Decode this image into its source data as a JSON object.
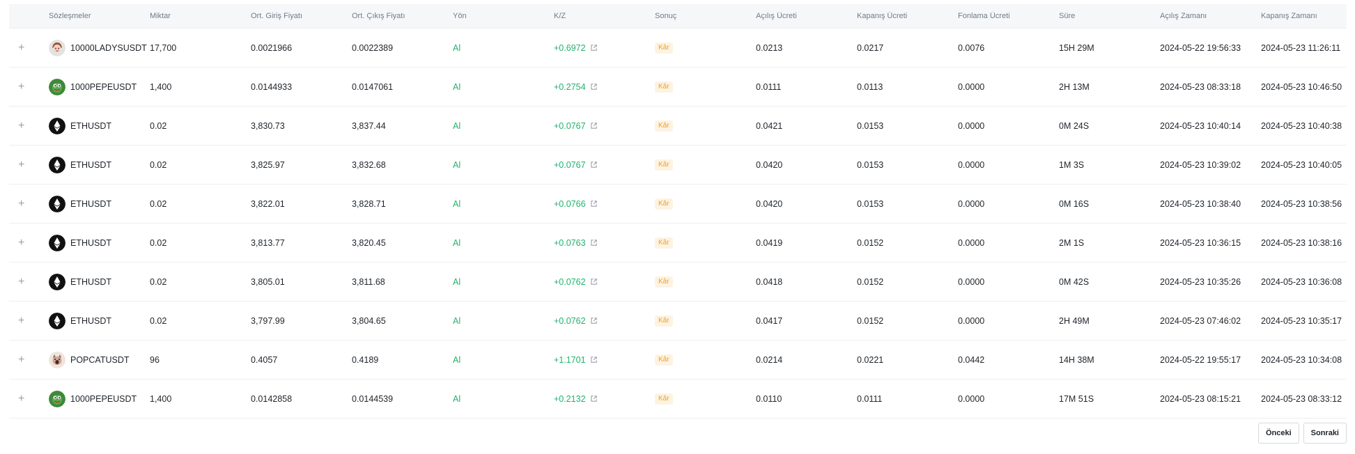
{
  "columns": [
    "Sözleşmeler",
    "Miktar",
    "Ort. Giriş Fiyatı",
    "Ort. Çıkış Fiyatı",
    "Yön",
    "K/Z",
    "Sonuç",
    "Açılış Ücreti",
    "Kapanış Ücreti",
    "Fonlama Ücreti",
    "Süre",
    "Açılış Zamanı",
    "Kapanış Zamanı"
  ],
  "rows": [
    {
      "contract": "10000LADYSUSDT",
      "coin_icon": "ladys-coin-icon",
      "qty": "17,700",
      "entry": "0.0021966",
      "exit": "0.0022389",
      "side": "Al",
      "pnl": "+0.6972",
      "result": "Kâr",
      "open_fee": "0.0213",
      "close_fee": "0.0217",
      "funding_fee": "0.0076",
      "duration": "15H 29M",
      "open_time": "2024-05-22 19:56:33",
      "close_time": "2024-05-23 11:26:11"
    },
    {
      "contract": "1000PEPEUSDT",
      "coin_icon": "pepe-coin-icon",
      "qty": "1,400",
      "entry": "0.0144933",
      "exit": "0.0147061",
      "side": "Al",
      "pnl": "+0.2754",
      "result": "Kâr",
      "open_fee": "0.0111",
      "close_fee": "0.0113",
      "funding_fee": "0.0000",
      "duration": "2H 13M",
      "open_time": "2024-05-23 08:33:18",
      "close_time": "2024-05-23 10:46:50"
    },
    {
      "contract": "ETHUSDT",
      "coin_icon": "eth-coin-icon",
      "qty": "0.02",
      "entry": "3,830.73",
      "exit": "3,837.44",
      "side": "Al",
      "pnl": "+0.0767",
      "result": "Kâr",
      "open_fee": "0.0421",
      "close_fee": "0.0153",
      "funding_fee": "0.0000",
      "duration": "0M 24S",
      "open_time": "2024-05-23 10:40:14",
      "close_time": "2024-05-23 10:40:38"
    },
    {
      "contract": "ETHUSDT",
      "coin_icon": "eth-coin-icon",
      "qty": "0.02",
      "entry": "3,825.97",
      "exit": "3,832.68",
      "side": "Al",
      "pnl": "+0.0767",
      "result": "Kâr",
      "open_fee": "0.0420",
      "close_fee": "0.0153",
      "funding_fee": "0.0000",
      "duration": "1M 3S",
      "open_time": "2024-05-23 10:39:02",
      "close_time": "2024-05-23 10:40:05"
    },
    {
      "contract": "ETHUSDT",
      "coin_icon": "eth-coin-icon",
      "qty": "0.02",
      "entry": "3,822.01",
      "exit": "3,828.71",
      "side": "Al",
      "pnl": "+0.0766",
      "result": "Kâr",
      "open_fee": "0.0420",
      "close_fee": "0.0153",
      "funding_fee": "0.0000",
      "duration": "0M 16S",
      "open_time": "2024-05-23 10:38:40",
      "close_time": "2024-05-23 10:38:56"
    },
    {
      "contract": "ETHUSDT",
      "coin_icon": "eth-coin-icon",
      "qty": "0.02",
      "entry": "3,813.77",
      "exit": "3,820.45",
      "side": "Al",
      "pnl": "+0.0763",
      "result": "Kâr",
      "open_fee": "0.0419",
      "close_fee": "0.0152",
      "funding_fee": "0.0000",
      "duration": "2M 1S",
      "open_time": "2024-05-23 10:36:15",
      "close_time": "2024-05-23 10:38:16"
    },
    {
      "contract": "ETHUSDT",
      "coin_icon": "eth-coin-icon",
      "qty": "0.02",
      "entry": "3,805.01",
      "exit": "3,811.68",
      "side": "Al",
      "pnl": "+0.0762",
      "result": "Kâr",
      "open_fee": "0.0418",
      "close_fee": "0.0152",
      "funding_fee": "0.0000",
      "duration": "0M 42S",
      "open_time": "2024-05-23 10:35:26",
      "close_time": "2024-05-23 10:36:08"
    },
    {
      "contract": "ETHUSDT",
      "coin_icon": "eth-coin-icon",
      "qty": "0.02",
      "entry": "3,797.99",
      "exit": "3,804.65",
      "side": "Al",
      "pnl": "+0.0762",
      "result": "Kâr",
      "open_fee": "0.0417",
      "close_fee": "0.0152",
      "funding_fee": "0.0000",
      "duration": "2H 49M",
      "open_time": "2024-05-23 07:46:02",
      "close_time": "2024-05-23 10:35:17"
    },
    {
      "contract": "POPCATUSDT",
      "coin_icon": "popcat-coin-icon",
      "qty": "96",
      "entry": "0.4057",
      "exit": "0.4189",
      "side": "Al",
      "pnl": "+1.1701",
      "result": "Kâr",
      "open_fee": "0.0214",
      "close_fee": "0.0221",
      "funding_fee": "0.0442",
      "duration": "14H 38M",
      "open_time": "2024-05-22 19:55:17",
      "close_time": "2024-05-23 10:34:08"
    },
    {
      "contract": "1000PEPEUSDT",
      "coin_icon": "pepe-coin-icon",
      "qty": "1,400",
      "entry": "0.0142858",
      "exit": "0.0144539",
      "side": "Al",
      "pnl": "+0.2132",
      "result": "Kâr",
      "open_fee": "0.0110",
      "close_fee": "0.0111",
      "funding_fee": "0.0000",
      "duration": "17M 51S",
      "open_time": "2024-05-23 08:15:21",
      "close_time": "2024-05-23 08:33:12"
    }
  ],
  "pagination": {
    "prev_label": "Önceki",
    "next_label": "Sonraki"
  },
  "colors": {
    "profit": "#20b26c",
    "badge_text": "#f0a020",
    "badge_bg": "#fdf3e3"
  }
}
